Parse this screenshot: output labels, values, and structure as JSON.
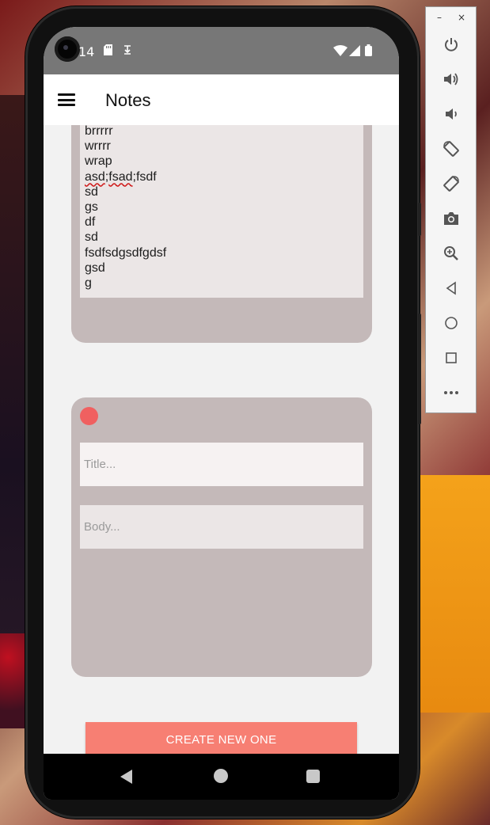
{
  "status_bar": {
    "time": "14",
    "icons": [
      "sd-card-icon",
      "download-icon",
      "wifi-icon",
      "signal-icon",
      "battery-icon"
    ]
  },
  "app_bar": {
    "title": "Notes",
    "menu_icon": "hamburger-menu-icon"
  },
  "notes": [
    {
      "body_lines": [
        "brrrrr",
        "wrrrr",
        "wrap",
        "asd;fsad;fsdf",
        "sd",
        "gs",
        "df",
        "sd",
        "fsdfsdgsdfgdsf",
        "gsd",
        "g"
      ]
    }
  ],
  "new_note": {
    "title_placeholder": "Title...",
    "body_placeholder": "Body...",
    "color": "#f06060"
  },
  "actions": {
    "create_label": "CREATE NEW ONE"
  },
  "emulator_panel": {
    "minimize": "–",
    "close": "×",
    "icons": [
      "power-icon",
      "volume-up-icon",
      "volume-down-icon",
      "rotate-left-icon",
      "rotate-right-icon",
      "camera-icon",
      "zoom-icon",
      "back-icon",
      "home-icon",
      "overview-icon",
      "more-icon"
    ]
  },
  "colors": {
    "card": "#c4b9b9",
    "button": "#f77f73",
    "status_bar": "#777777"
  }
}
